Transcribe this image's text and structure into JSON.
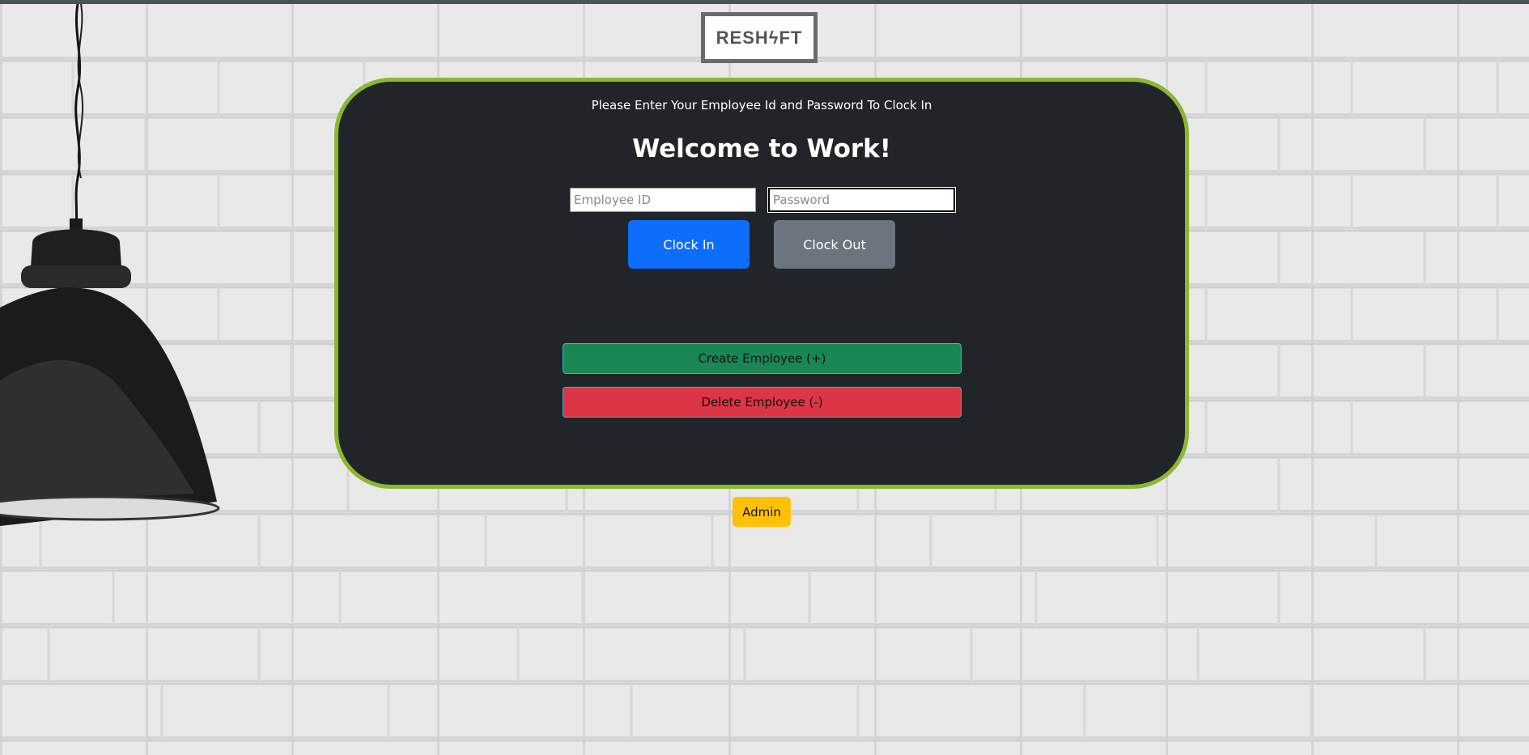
{
  "brand": {
    "logo_text": "RESHϟFT"
  },
  "login_card": {
    "subtitle": "Please Enter Your Employee Id and Password To Clock In",
    "heading": "Welcome to Work!",
    "employee_id": {
      "value": "",
      "placeholder": "Employee ID"
    },
    "password": {
      "value": "",
      "placeholder": "Password"
    },
    "clock_in_label": "Clock In",
    "clock_out_label": "Clock Out",
    "create_employee_label": "Create Employee (+)",
    "delete_employee_label": "Delete Employee (-)"
  },
  "admin_label": "Admin",
  "colors": {
    "card_bg": "#212529",
    "card_border": "#8ab830",
    "primary": "#0d6efd",
    "secondary": "#6c757d",
    "success": "#198754",
    "danger": "#dc3545",
    "warning": "#ffc107"
  },
  "icons": {
    "lamp": "pendant-lamp-icon",
    "logo_bolt": "lightning-bolt-icon"
  }
}
